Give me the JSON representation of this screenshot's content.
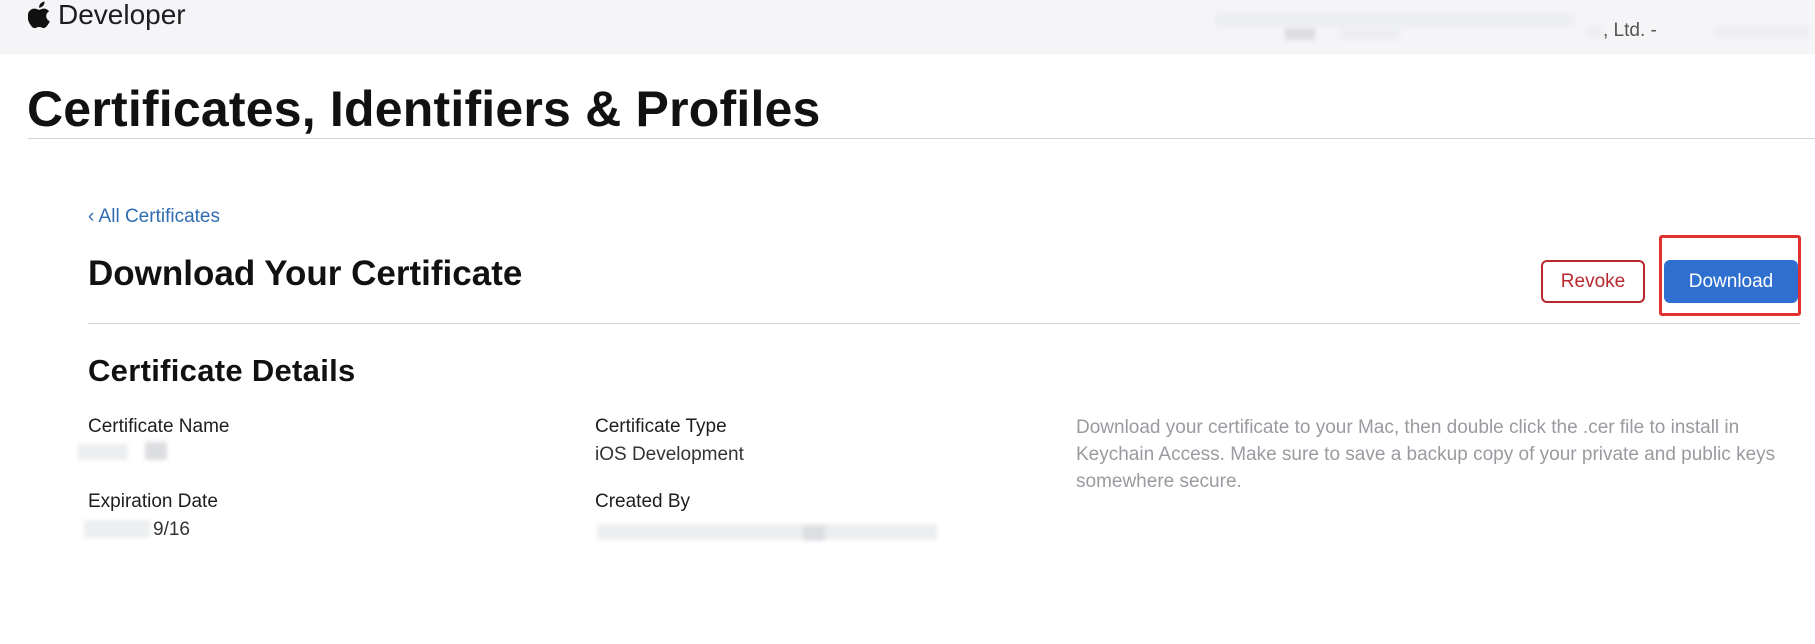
{
  "header": {
    "brand_label": "Developer",
    "team_name": ", Ltd. -"
  },
  "page": {
    "title": "Certificates, Identifiers & Profiles"
  },
  "nav": {
    "back_link": "‹ All Certificates"
  },
  "section": {
    "title": "Download Your Certificate",
    "revoke_label": "Revoke",
    "download_label": "Download"
  },
  "details": {
    "title": "Certificate Details",
    "name_label": "Certificate Name",
    "type_label": "Certificate Type",
    "type_value": "iOS Development",
    "expiration_label": "Expiration Date",
    "expiration_value": "9/16",
    "created_by_label": "Created By",
    "info": "Download your certificate to your Mac, then double click the .cer file to install in Keychain Access. Make sure to save a backup copy of your private and public keys somewhere secure."
  },
  "colors": {
    "link": "#2f6db3",
    "primary_button": "#2f6fcf",
    "destructive": "#b8292f",
    "highlight": "#e03030"
  },
  "icons": {
    "brand": "apple-logo-icon"
  }
}
